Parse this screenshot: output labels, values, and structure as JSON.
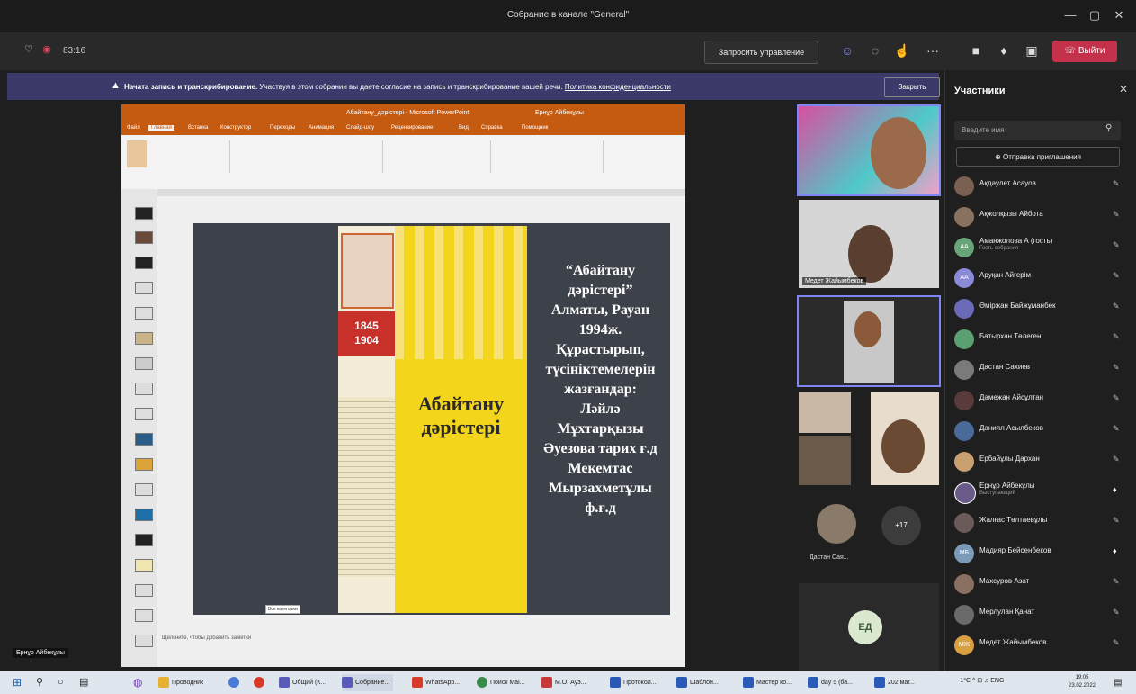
{
  "window": {
    "title": "Собрание в канале \"General\"",
    "minimize": "—",
    "maximize": "▢",
    "close": "✕"
  },
  "toolbar": {
    "timer": "83:16",
    "request_control": "Запросить управление",
    "leave": "Выйти",
    "more": "···"
  },
  "banner": {
    "bold": "Начата запись и транскрибирование.",
    "text": "Участвуя в этом собрании вы даете согласие на запись и транскрибирование вашей речи.",
    "link": "Политика конфиденциальности",
    "close": "Закрыть"
  },
  "ppt": {
    "title": "Абайтану_дәрістері - Microsoft PowerPoint",
    "user": "Ернұр Айбекұлы",
    "tabs": [
      "Файл",
      "Главная",
      "Вставка",
      "Конструктор",
      "Переходы",
      "Анимация",
      "Слайд-шоу",
      "Рецензирование",
      "Вид",
      "Справка",
      "Помощник"
    ],
    "notes_placeholder": "Щелкните, чтобы добавить заметки",
    "tooltip": "Все категории"
  },
  "slide": {
    "years": [
      "1845",
      "1904"
    ],
    "book_title": [
      "Абайтану",
      "дәрістері"
    ],
    "lines": [
      "“Абайтану",
      "дәрістері”",
      "Алматы, Рауан",
      "1994ж.",
      "Құрастырып,",
      "түсініктемелерін",
      "жазғандар:",
      "Ләйлә",
      "Мұхтарқызы",
      "Әуезова тарих ғ.д",
      "Мекемтас",
      "Мырзахметұлы",
      "ф.ғ.д"
    ]
  },
  "tiles": {
    "tile2_name": "Медет Жайымбеков",
    "group_name": "Дастан Сая...",
    "more_count": "+17",
    "ed_initials": "ЕД"
  },
  "presenter": "Ернұр Айбекұлы",
  "panel": {
    "title": "Участники",
    "search_placeholder": "Введите имя",
    "invite": "Отправка приглашения",
    "participants": [
      {
        "name": "Ақдәулет Асауов",
        "sub": ""
      },
      {
        "name": "Ақжолқызы Айбота",
        "sub": ""
      },
      {
        "name": "Аманжолова А (гость)",
        "sub": "Гость собрания"
      },
      {
        "name": "Аруқан Айгерім",
        "sub": ""
      },
      {
        "name": "Әміржан Байжұманбек",
        "sub": ""
      },
      {
        "name": "Батырхан Төлеген",
        "sub": ""
      },
      {
        "name": "Дастан Сахиев",
        "sub": ""
      },
      {
        "name": "Дәмежан Айсұлтан",
        "sub": ""
      },
      {
        "name": "Даниял Асылбеков",
        "sub": ""
      },
      {
        "name": "Ербайұлы Дархан",
        "sub": ""
      },
      {
        "name": "Ернұр Айбекұлы",
        "sub": "Выступающий"
      },
      {
        "name": "Жалғас Төлтаевұлы",
        "sub": ""
      },
      {
        "name": "Мадияр Бейсенбеков",
        "sub": ""
      },
      {
        "name": "Махсуров Азат",
        "sub": ""
      },
      {
        "name": "Мерлулан Қанат",
        "sub": ""
      },
      {
        "name": "Медет Жайымбеков",
        "sub": ""
      }
    ]
  },
  "taskbar": {
    "apps": [
      "Проводник",
      "",
      "",
      "Общий (К...",
      "Собрание...",
      "WhatsApp...",
      "Поиск Mai...",
      "М.О. Ауэ...",
      "Протокол...",
      "Шаблон...",
      "Мастер ко...",
      "day 5 (ба...",
      "202 маг..."
    ],
    "tray": "-1°C ^ ⊡ ♫ ENG",
    "time": "19:05",
    "date": "23.02.2022"
  },
  "colors": {
    "accent": "#7f85f5",
    "leave": "#c4314b",
    "ppt": "#c55a11",
    "banner": "#3b3a6b"
  }
}
